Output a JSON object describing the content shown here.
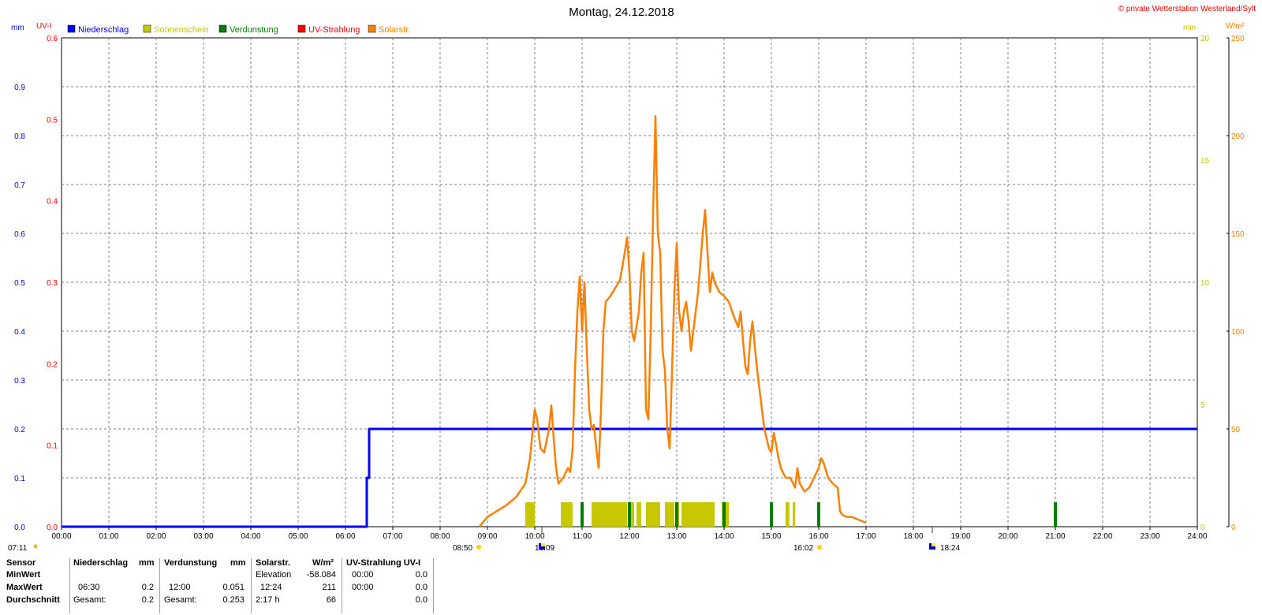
{
  "title": "Montag, 24.12.2018",
  "copyright": "© private Wetterstation Westerland/Sylt",
  "units": {
    "mm": "mm",
    "uvi": "UV-I",
    "min": "min",
    "wm2": "W/m²"
  },
  "legend": [
    {
      "label": "Niederschlag",
      "color": "#0000ff"
    },
    {
      "label": "Sonnenschein",
      "color": "#c8c800"
    },
    {
      "label": "Verdunstung",
      "color": "#008000"
    },
    {
      "label": "UV-Strahlung",
      "color": "#ff0000"
    },
    {
      "label": "Solarstr.",
      "color": "#ff8000"
    }
  ],
  "sun_events": {
    "sunrise": "07:11",
    "culmination_start": "08:50",
    "culmination_icon": "10:09",
    "sun_end": "16:02",
    "sunset": "18:24"
  },
  "chart_data": {
    "type": "line",
    "x_ticks": [
      "00:00",
      "01:00",
      "02:00",
      "03:00",
      "04:00",
      "05:00",
      "06:00",
      "07:00",
      "08:00",
      "09:00",
      "10:00",
      "11:00",
      "12:00",
      "13:00",
      "14:00",
      "15:00",
      "16:00",
      "17:00",
      "18:00",
      "19:00",
      "20:00",
      "21:00",
      "22:00",
      "23:00",
      "24:00"
    ],
    "xlim_hours": [
      0,
      24
    ],
    "axes": {
      "mm": {
        "ticks": [
          "0.0",
          "0.1",
          "0.2",
          "0.3",
          "0.4",
          "0.5",
          "0.6",
          "0.7",
          "0.8",
          "0.9"
        ],
        "range": [
          0,
          1.0
        ],
        "color": "#0000ff"
      },
      "uvi": {
        "ticks": [
          "0.0",
          "0.1",
          "0.2",
          "0.3",
          "0.4",
          "0.5",
          "0.6"
        ],
        "range": [
          0,
          0.6
        ],
        "color": "#ff0000"
      },
      "min": {
        "ticks": [
          "0",
          "5",
          "10",
          "15",
          "20"
        ],
        "range": [
          0,
          20
        ],
        "color": "#c8c800"
      },
      "wm2": {
        "ticks": [
          "0",
          "50",
          "100",
          "150",
          "200",
          "250"
        ],
        "range": [
          0,
          250
        ],
        "color": "#ff8000"
      }
    },
    "grid": true,
    "series": [
      {
        "name": "Niederschlag",
        "axis": "mm",
        "color": "#0000ff",
        "step": true,
        "points": [
          [
            0,
            0
          ],
          [
            6.45,
            0
          ],
          [
            6.45,
            0.1
          ],
          [
            6.5,
            0.1
          ],
          [
            6.5,
            0.2
          ],
          [
            24,
            0.2
          ]
        ]
      },
      {
        "name": "Solarstr.",
        "axis": "wm2",
        "color": "#ff8000",
        "points": [
          [
            8.83,
            0
          ],
          [
            9.0,
            5
          ],
          [
            9.2,
            8
          ],
          [
            9.4,
            11
          ],
          [
            9.6,
            15
          ],
          [
            9.8,
            22
          ],
          [
            9.9,
            35
          ],
          [
            9.95,
            48
          ],
          [
            10.0,
            60
          ],
          [
            10.05,
            55
          ],
          [
            10.12,
            40
          ],
          [
            10.2,
            38
          ],
          [
            10.3,
            50
          ],
          [
            10.35,
            62
          ],
          [
            10.4,
            45
          ],
          [
            10.45,
            30
          ],
          [
            10.5,
            22
          ],
          [
            10.6,
            25
          ],
          [
            10.7,
            30
          ],
          [
            10.75,
            28
          ],
          [
            10.8,
            40
          ],
          [
            10.85,
            80
          ],
          [
            10.9,
            110
          ],
          [
            10.95,
            128
          ],
          [
            11.0,
            100
          ],
          [
            11.05,
            125
          ],
          [
            11.1,
            90
          ],
          [
            11.15,
            60
          ],
          [
            11.2,
            50
          ],
          [
            11.25,
            52
          ],
          [
            11.3,
            40
          ],
          [
            11.35,
            30
          ],
          [
            11.4,
            60
          ],
          [
            11.45,
            100
          ],
          [
            11.5,
            115
          ],
          [
            11.6,
            118
          ],
          [
            11.7,
            122
          ],
          [
            11.8,
            126
          ],
          [
            11.9,
            140
          ],
          [
            11.95,
            148
          ],
          [
            12.0,
            130
          ],
          [
            12.05,
            100
          ],
          [
            12.1,
            95
          ],
          [
            12.2,
            110
          ],
          [
            12.25,
            130
          ],
          [
            12.3,
            140
          ],
          [
            12.35,
            60
          ],
          [
            12.4,
            55
          ],
          [
            12.45,
            100
          ],
          [
            12.5,
            160
          ],
          [
            12.55,
            210
          ],
          [
            12.6,
            150
          ],
          [
            12.65,
            140
          ],
          [
            12.7,
            90
          ],
          [
            12.75,
            80
          ],
          [
            12.8,
            50
          ],
          [
            12.85,
            40
          ],
          [
            12.9,
            80
          ],
          [
            12.95,
            120
          ],
          [
            13.0,
            145
          ],
          [
            13.05,
            110
          ],
          [
            13.1,
            100
          ],
          [
            13.15,
            110
          ],
          [
            13.2,
            115
          ],
          [
            13.25,
            105
          ],
          [
            13.3,
            90
          ],
          [
            13.35,
            100
          ],
          [
            13.4,
            110
          ],
          [
            13.45,
            120
          ],
          [
            13.5,
            135
          ],
          [
            13.55,
            150
          ],
          [
            13.6,
            162
          ],
          [
            13.65,
            140
          ],
          [
            13.7,
            120
          ],
          [
            13.75,
            130
          ],
          [
            13.8,
            125
          ],
          [
            13.9,
            120
          ],
          [
            14.0,
            118
          ],
          [
            14.1,
            115
          ],
          [
            14.2,
            108
          ],
          [
            14.3,
            102
          ],
          [
            14.35,
            110
          ],
          [
            14.4,
            95
          ],
          [
            14.45,
            82
          ],
          [
            14.5,
            78
          ],
          [
            14.55,
            95
          ],
          [
            14.6,
            105
          ],
          [
            14.65,
            92
          ],
          [
            14.7,
            80
          ],
          [
            14.75,
            70
          ],
          [
            14.8,
            60
          ],
          [
            14.85,
            50
          ],
          [
            14.9,
            45
          ],
          [
            14.95,
            40
          ],
          [
            15.0,
            38
          ],
          [
            15.05,
            48
          ],
          [
            15.1,
            42
          ],
          [
            15.15,
            35
          ],
          [
            15.2,
            30
          ],
          [
            15.3,
            25
          ],
          [
            15.4,
            25
          ],
          [
            15.5,
            20
          ],
          [
            15.55,
            30
          ],
          [
            15.6,
            22
          ],
          [
            15.7,
            18
          ],
          [
            15.8,
            20
          ],
          [
            15.9,
            25
          ],
          [
            16.0,
            30
          ],
          [
            16.05,
            35
          ],
          [
            16.1,
            33
          ],
          [
            16.2,
            25
          ],
          [
            16.3,
            22
          ],
          [
            16.4,
            20
          ],
          [
            16.45,
            8
          ],
          [
            16.5,
            6
          ],
          [
            16.6,
            5
          ],
          [
            16.7,
            5
          ],
          [
            16.8,
            4
          ],
          [
            16.9,
            3
          ],
          [
            17.0,
            2
          ]
        ]
      },
      {
        "name": "Sonnenschein",
        "axis": "min",
        "color": "#c8c800",
        "type": "bar",
        "bars": [
          [
            9.8,
            10.0
          ],
          [
            10.55,
            10.8
          ],
          [
            11.2,
            11.95
          ],
          [
            12.0,
            12.1
          ],
          [
            12.15,
            12.25
          ],
          [
            12.35,
            12.65
          ],
          [
            12.75,
            12.95
          ],
          [
            13.0,
            13.05
          ],
          [
            13.1,
            13.8
          ],
          [
            13.95,
            14.1
          ],
          [
            15.3,
            15.38
          ],
          [
            15.45,
            15.5
          ]
        ],
        "bar_value": 1
      },
      {
        "name": "Verdunstung",
        "axis": "mm",
        "color": "#008000",
        "type": "spike",
        "spikes": [
          [
            11.0,
            0.05
          ],
          [
            12.0,
            0.05
          ],
          [
            13.0,
            0.05
          ],
          [
            14.0,
            0.05
          ],
          [
            15.0,
            0.05
          ],
          [
            16.0,
            0.05
          ],
          [
            21.0,
            0.05
          ]
        ]
      },
      {
        "name": "UV-Strahlung",
        "axis": "uvi",
        "color": "#ff0000",
        "points": []
      }
    ]
  },
  "stats": {
    "header": {
      "sensor": "Sensor",
      "nieder": "Niederschlag",
      "nieder_unit": "mm",
      "verd": "Verdunstung",
      "verd_unit": "mm",
      "solar": "Solarstr.",
      "solar_unit": "W/m²",
      "uv": "UV-Strahlung UV-I"
    },
    "min": {
      "label": "MinWert",
      "solar_time": "Elevation",
      "solar_val": "-58.084",
      "uv_time": "00:00",
      "uv_val": "0.0"
    },
    "max": {
      "label": "MaxWert",
      "nieder_time": "06:30",
      "nieder_val": "0.2",
      "verd_time": "12:00",
      "verd_val": "0.051",
      "solar_time": "12:24",
      "solar_val": "211",
      "uv_time": "00:00",
      "uv_val": "0.0"
    },
    "avg": {
      "label": "Durchschnitt",
      "nieder_time": "Gesamt:",
      "nieder_val": "0.2",
      "verd_time": "Gesamt:",
      "verd_val": "0.253",
      "solar_time": "2:17 h",
      "solar_val": "66",
      "uv_val": "0.0"
    }
  }
}
